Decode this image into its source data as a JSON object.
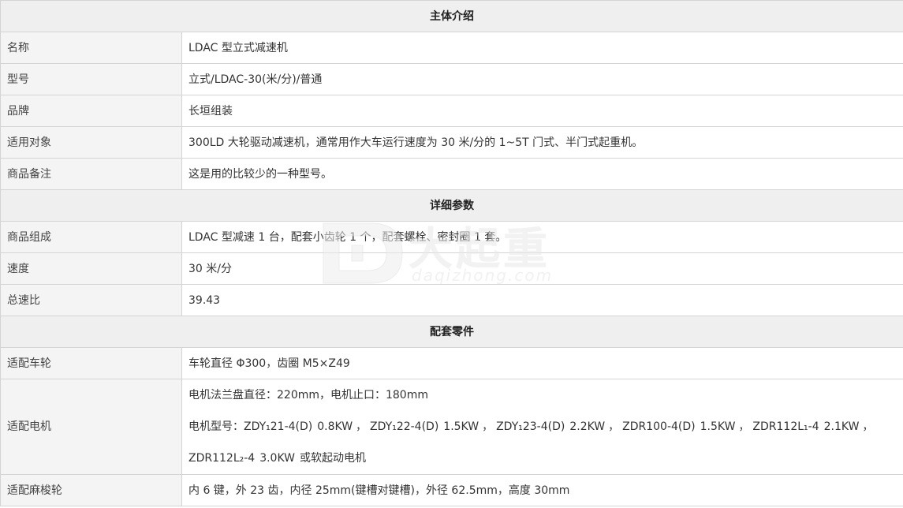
{
  "sections": {
    "intro": "主体介绍",
    "details": "详细参数",
    "parts": "配套零件"
  },
  "rows": {
    "name": {
      "label": "名称",
      "value": "LDAC 型立式减速机"
    },
    "model": {
      "label": "型号",
      "value": "立式/LDAC-30(米/分)/普通"
    },
    "brand": {
      "label": "品牌",
      "value": "长垣组装"
    },
    "target": {
      "label": "适用对象",
      "value": "300LD 大轮驱动减速机，通常用作大车运行速度为 30 米/分的 1~5T 门式、半门式起重机。"
    },
    "remark": {
      "label": "商品备注",
      "value": "这是用的比较少的一种型号。"
    },
    "composition": {
      "label": "商品组成",
      "value": "LDAC 型减速 1 台，配套小齿轮 1 个，配套螺栓、密封圈 1 套。"
    },
    "speed": {
      "label": "速度",
      "value": "30 米/分"
    },
    "ratio": {
      "label": "总速比",
      "value": "39.43"
    },
    "wheel": {
      "label": "适配车轮",
      "value": "车轮直径 Φ300，齿圈 M5×Z49"
    },
    "motor": {
      "label": "适配电机",
      "line1": "电机法兰盘直径：220mm，电机止口：180mm",
      "line2_prefix": "电机型号：",
      "motors": [
        {
          "model": "ZDY₁21-4(D)",
          "power": "0.8KW"
        },
        {
          "model": "ZDY₁22-4(D)",
          "power": "1.5KW"
        },
        {
          "model": "ZDY₁23-4(D)",
          "power": "2.2KW"
        },
        {
          "model": "ZDR100-4(D)",
          "power": "1.5KW"
        },
        {
          "model": "ZDR112L₁-4",
          "power": "2.1KW"
        }
      ],
      "separator": "，",
      "line3_model": "ZDR112L₂-4",
      "line3_power": "3.0KW",
      "line3_suffix": "或软起动电机"
    },
    "pulley": {
      "label": "适配麻梭轮",
      "value": "内 6 键，外 23 齿，内径 25mm(键槽对键槽)，外径 62.5mm，高度 30mm"
    }
  },
  "watermark": {
    "cn": "大起重",
    "en": "daqizhong.com"
  }
}
